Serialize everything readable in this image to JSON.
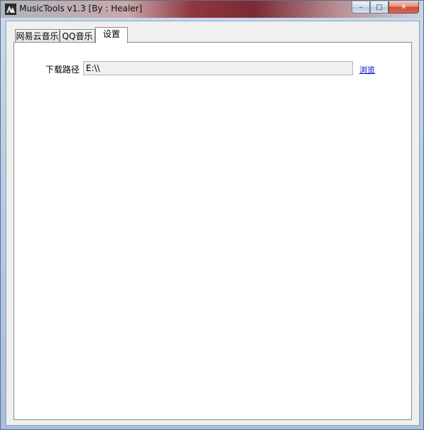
{
  "window": {
    "title": "MusicTools v1.3 [By : Healer]",
    "icon": "app-icon",
    "controls": {
      "minimize": "–",
      "maximize": "□",
      "close": "✕"
    }
  },
  "tabs": [
    {
      "label": "网易云音乐",
      "active": false
    },
    {
      "label": "QQ音乐",
      "active": false
    },
    {
      "label": "设置",
      "active": true
    }
  ],
  "settings": {
    "download_path_label": "下载路径",
    "download_path_value": "E:\\\\",
    "browse_label": "浏览"
  },
  "colors": {
    "link": "#0000cc",
    "close_button": "#cf4b36",
    "frame": "#b9cde3"
  }
}
